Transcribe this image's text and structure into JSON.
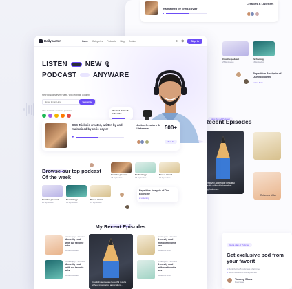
{
  "brand": {
    "name": "Dailycaster",
    "accent": "#6c4df6"
  },
  "nav": {
    "links": [
      "Home",
      "Categories",
      "Podcasts",
      "Blog",
      "Contact"
    ],
    "cta": "Sign in"
  },
  "hero": {
    "line1a": "LISTEN",
    "line1b": "NEW",
    "line2a": "PODCAST",
    "line2b": "ANYWARE",
    "subtitle": "New episodes every week, with Michelle Colomb",
    "email_placeholder": "Enter Email Here",
    "subscribe": "Subscribe",
    "available": "Also available on these platforms",
    "episode_card": "Affected rhyme & Subscribe"
  },
  "featured": {
    "title": "CSS Tricks is created, written by and maintained by chris coyier",
    "stat_label": "Active Creators & Listeners",
    "stat_value": "500+",
    "view_all": "View All"
  },
  "browse": {
    "tag": "Most Joined Podcasts",
    "title": "Browse our top podcast Of the week",
    "tiles": [
      {
        "name": "Creative podcast",
        "count": "25 Episodes"
      },
      {
        "name": "Technology",
        "count": "16 Episodes"
      },
      {
        "name": "Tour & Travel",
        "count": "12 Episodes"
      }
    ],
    "row2": [
      {
        "name": "Creative podcast",
        "count": "25 Episodes"
      },
      {
        "name": "Technology",
        "count": "16 Episodes"
      },
      {
        "name": "Tour & Travel",
        "count": "12 Episodes"
      }
    ],
    "listen_card": "Repetitive Analysis of Our Economy",
    "listen_label": "Listening"
  },
  "recent": {
    "tag": "Most Joined Podcast",
    "title": "My Recent Episodes",
    "items": [
      {
        "meta": "4 Category · 10 mins",
        "title": "A mostly read with our favorite arts",
        "author": "Rebecca Miller"
      },
      {
        "meta": "4 Category · 10 mins",
        "title": "A mostly read with our favorite arts",
        "author": "Rebecca Miller"
      },
      {
        "meta": "4 Category · 10 mins",
        "title": "A mostly read with our favorite arts",
        "author": "Rebecca Miller"
      },
      {
        "meta": "4 Category · 10 mins",
        "title": "A mostly read with our favorite arts",
        "author": "Rebecca Miller"
      }
    ],
    "center_caption": "Creativity aggregate beautiful results without information applications..."
  },
  "back": {
    "top_title": "maintained by chris coyier",
    "top_right": "Creators & Listeners",
    "creative": "Creative podcast",
    "creative_count": "25 Episodes",
    "tech": "Technology",
    "tech_count": "16 Episodes",
    "repetitive": "Repetitive Analysis of Our Economy",
    "listen": "Listen Now",
    "tag": "Most Joined Podcast",
    "recent_title": "Recent Episodes",
    "caption": "Creativity aggregate beautiful results without information applications...",
    "list_author": "Rebecca Miller",
    "exclusive_tag": "Get a plan of Podcast",
    "exclusive_title": "Get exclusive pod from your favorit",
    "check1": "Monthly 3 to 5 podcasts of all time",
    "check2": "Subscribe to exclusive podcast",
    "person_name": "Tommy Shaw",
    "person_role": "Podcaster"
  }
}
